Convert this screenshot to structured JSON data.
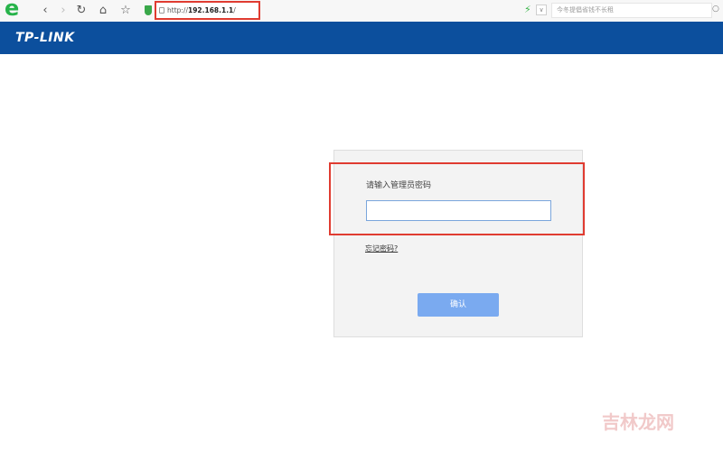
{
  "browser": {
    "logo": "e",
    "nav": {
      "back": "‹",
      "forward": "›",
      "refresh": "↻",
      "home": "⌂",
      "favorite": "☆"
    },
    "address": {
      "scheme": "http://",
      "host": "192.168.1.1",
      "path": "/"
    },
    "dropdown": "∨",
    "search": {
      "placeholder": "今冬提倡省钱不长租"
    },
    "search_icon": "○"
  },
  "header": {
    "brand": "TP-LINK"
  },
  "login": {
    "label": "请输入管理员密码",
    "password_value": "",
    "forgot_link": "忘记密码?",
    "confirm_button": "确认"
  },
  "watermark": "吉林龙网",
  "colors": {
    "brand_bar": "#0c4f9d",
    "highlight": "#e03c31",
    "button": "#7aaaf0",
    "panel": "#f3f3f3"
  }
}
